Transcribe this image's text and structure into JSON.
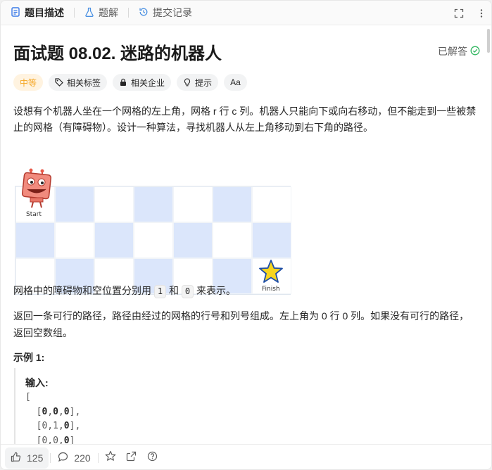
{
  "tabs": [
    {
      "label": "题目描述",
      "icon": "document-icon",
      "active": true
    },
    {
      "label": "题解",
      "icon": "flask-icon",
      "active": false
    },
    {
      "label": "提交记录",
      "icon": "history-icon",
      "active": false
    }
  ],
  "header_actions": {
    "expand_icon": "fullscreen-icon",
    "more_icon": "more-icon"
  },
  "problem": {
    "title": "面试题 08.02. 迷路的机器人",
    "status": "已解答"
  },
  "tags": {
    "difficulty": "中等",
    "related_tags": "相关标签",
    "related_companies": "相关企业",
    "hint": "提示",
    "font_toggle": "Aa"
  },
  "description": "设想有个机器人坐在一个网格的左上角，网格 r 行 c 列。机器人只能向下或向右移动，但不能走到一些被禁止的网格（有障碍物）。设计一种算法，寻找机器人从左上角移动到右下角的路径。",
  "figure": {
    "start_label": "Start",
    "finish_label": "Finish"
  },
  "grid_note": {
    "prefix": "网格中的障碍物和空位置分别用",
    "one": "1",
    "and": "和",
    "zero": "0",
    "suffix": "来表示。"
  },
  "return_note": "返回一条可行的路径，路径由经过的网格的行号和列号组成。左上角为 0 行 0 列。如果没有可行的路径，返回空数组。",
  "example": {
    "title": "示例 1:",
    "input_label": "输入:",
    "lines": [
      "[",
      "  [0,0,0],",
      "  [0,1,0],",
      "  [0,0,0]"
    ]
  },
  "footer": {
    "likes": "125",
    "comments": "220"
  },
  "colors": {
    "difficulty": "#f5a623",
    "grid_blue": "#dbe6fb",
    "solved_green": "#2db55d"
  }
}
